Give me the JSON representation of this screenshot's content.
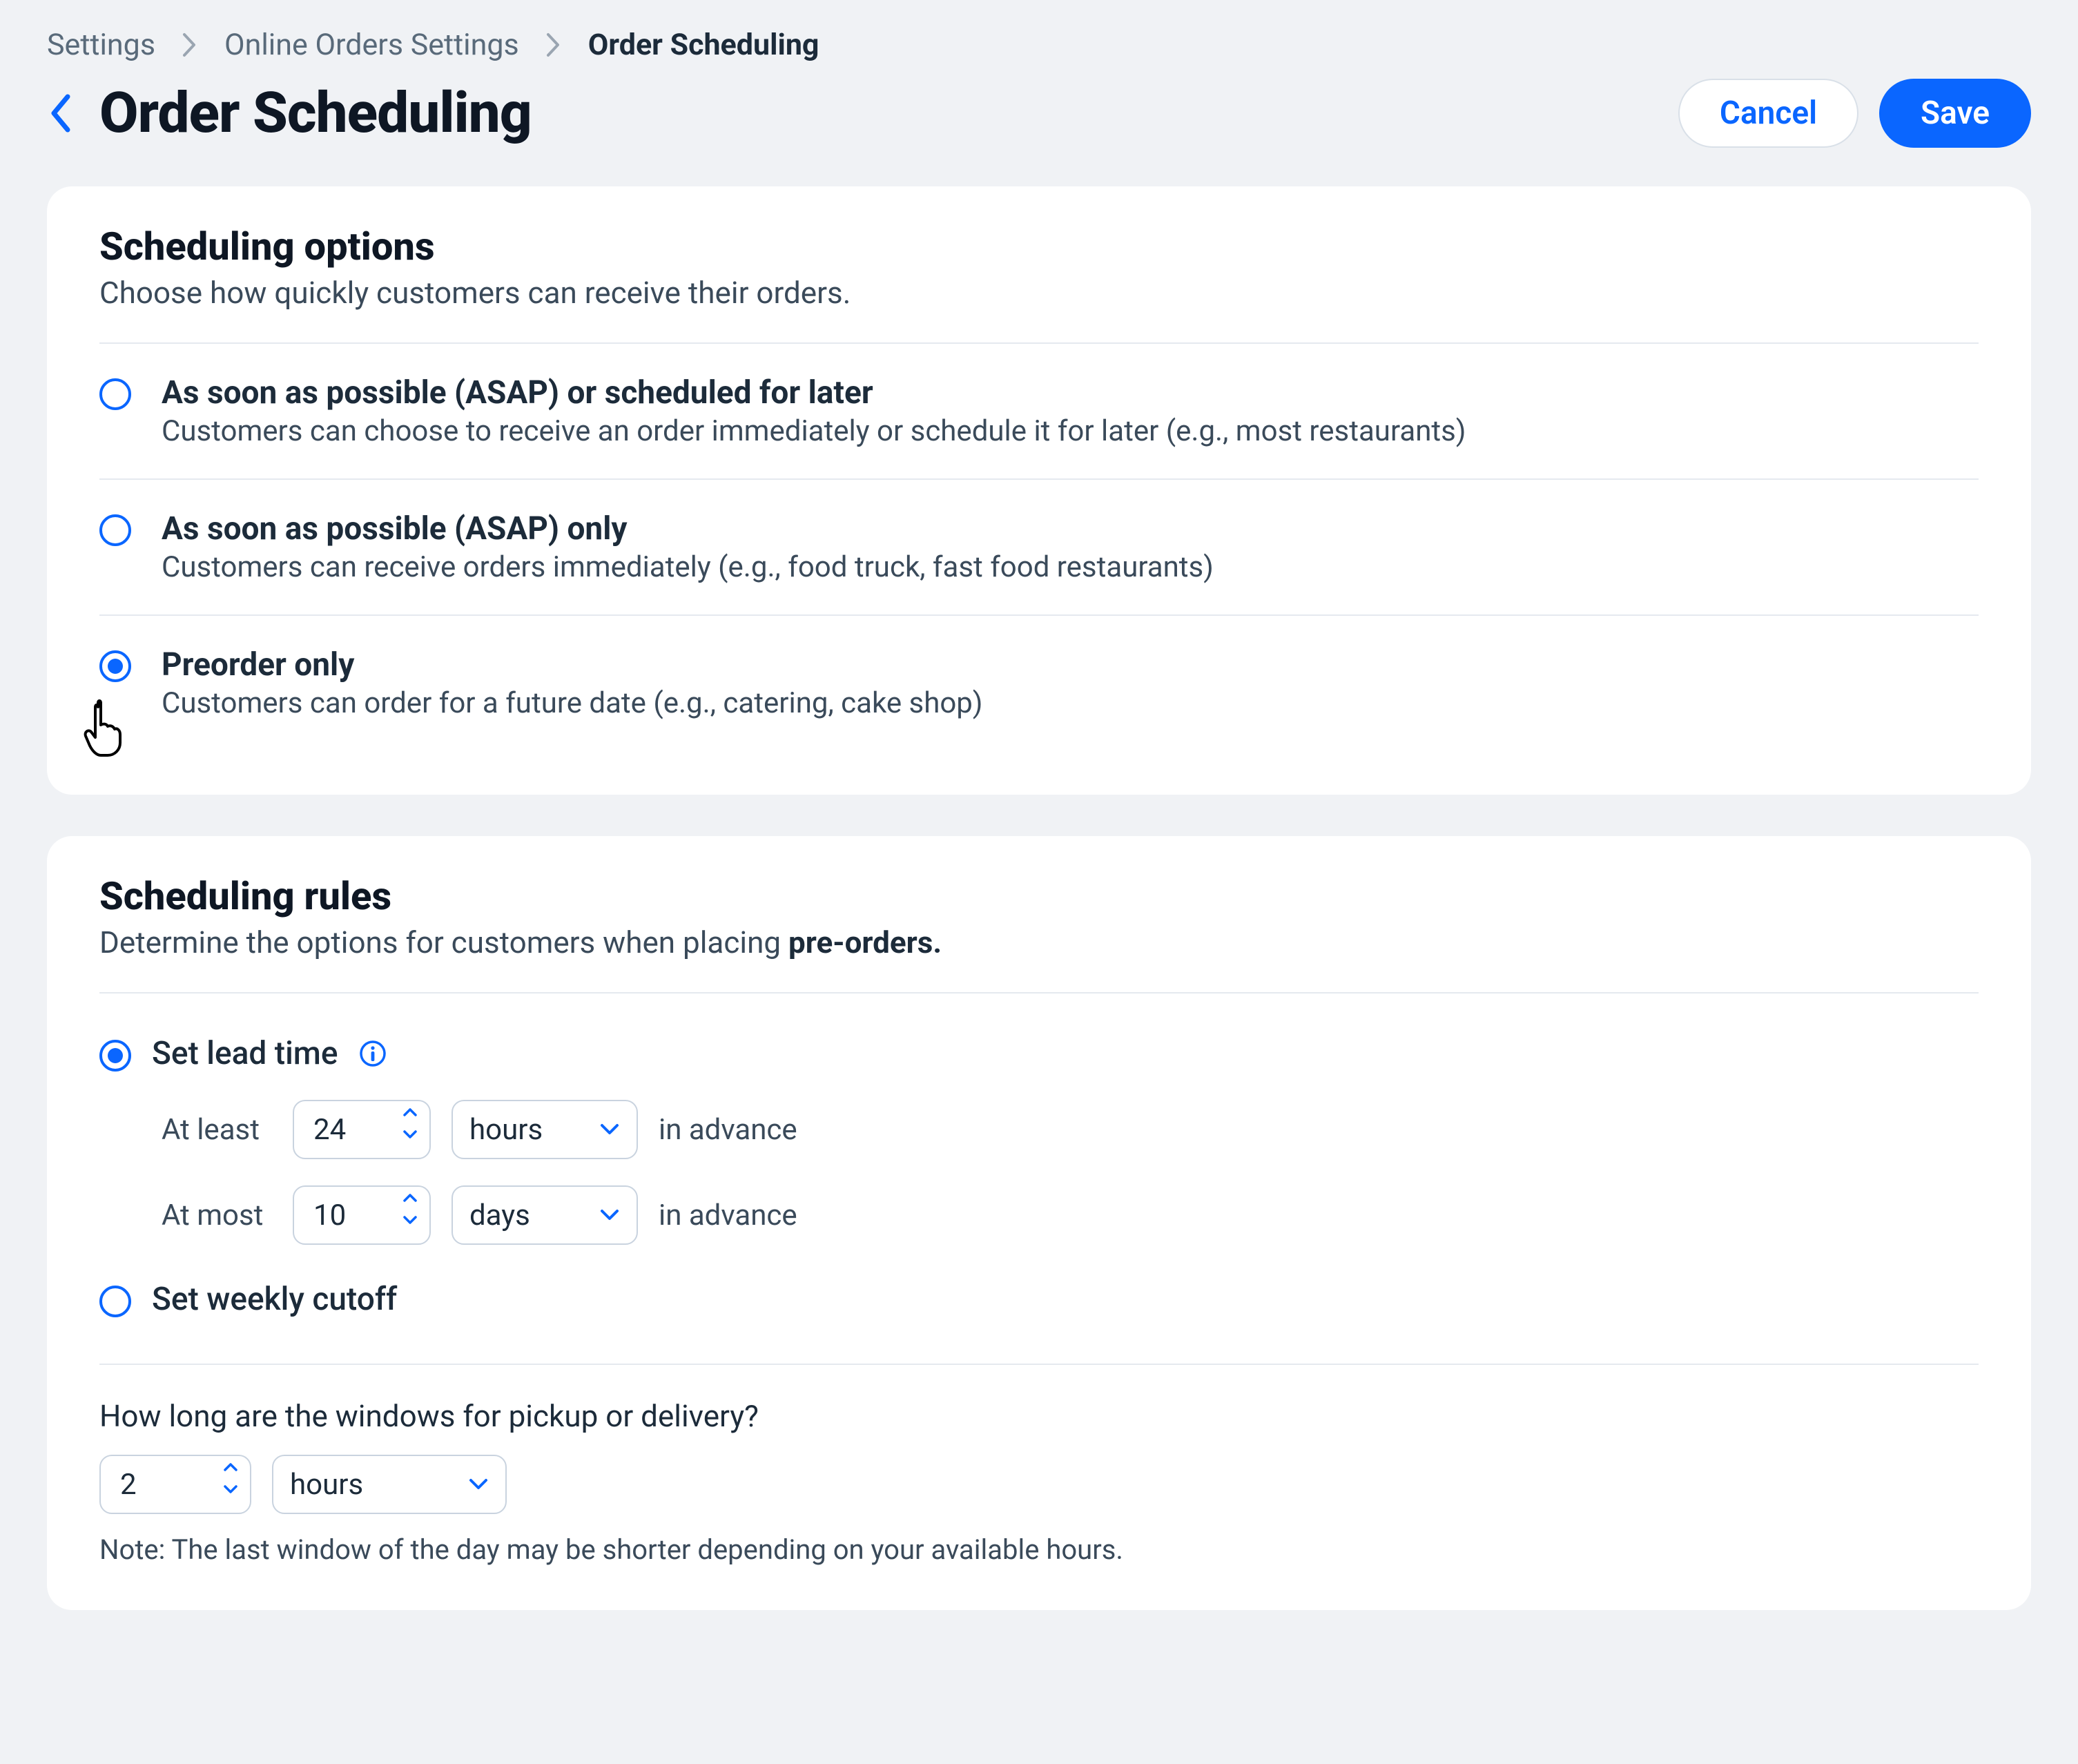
{
  "breadcrumb": {
    "items": [
      "Settings",
      "Online Orders Settings",
      "Order Scheduling"
    ]
  },
  "header": {
    "title": "Order Scheduling",
    "cancel": "Cancel",
    "save": "Save"
  },
  "scheduling_options": {
    "title": "Scheduling options",
    "subtitle": "Choose how quickly customers can receive their orders.",
    "options": [
      {
        "title": "As soon as possible (ASAP) or scheduled for later",
        "desc": "Customers can choose to receive an order immediately or schedule it for later (e.g., most restaurants)",
        "selected": false
      },
      {
        "title": "As soon as possible (ASAP)  only",
        "desc": "Customers can receive orders immediately (e.g., food truck, fast food restaurants)",
        "selected": false
      },
      {
        "title": "Preorder only",
        "desc": "Customers can order for a future date (e.g., catering, cake shop)",
        "selected": true
      }
    ]
  },
  "scheduling_rules": {
    "title": "Scheduling rules",
    "subtitle_prefix": "Determine the options for customers when placing ",
    "subtitle_strong": "pre-orders.",
    "lead_time": {
      "label": "Set lead time",
      "selected": true,
      "at_least_label": "At least",
      "at_least_value": "24",
      "at_least_unit": "hours",
      "at_most_label": "At most",
      "at_most_value": "10",
      "at_most_unit": "days",
      "suffix": "in advance"
    },
    "weekly_cutoff": {
      "label": "Set weekly cutoff",
      "selected": false
    },
    "window": {
      "question": "How long are the windows for pickup or delivery?",
      "value": "2",
      "unit": "hours",
      "note": "Note: The last window of the day may be shorter depending on your available hours."
    }
  }
}
